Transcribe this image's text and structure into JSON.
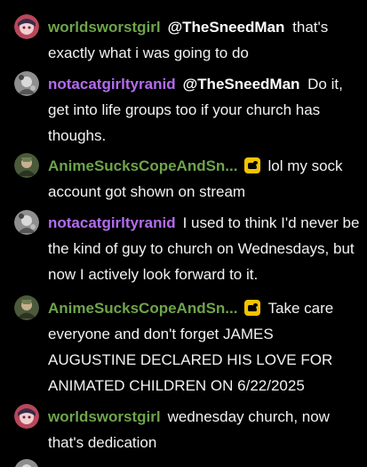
{
  "messages": [
    {
      "username": "worldsworstgirl",
      "user_color": "#6ea44b",
      "avatar": "anime-girl-avatar",
      "mention": "@TheSneedMan",
      "text": "that's exactly what i was going to do"
    },
    {
      "username": "notacatgirltyranid",
      "user_color": "#b36cf0",
      "avatar": "grey-avatar",
      "mention": "@TheSneedMan",
      "text": "Do it, get into life groups too if your church has thoughs."
    },
    {
      "username": "AnimeSucksCopeAndSn...",
      "user_color": "#6ea44b",
      "avatar": "green-avatar",
      "badge": "sub-badge-icon",
      "text": "lol my sock account got shown on stream"
    },
    {
      "username": "notacatgirltyranid",
      "user_color": "#b36cf0",
      "avatar": "grey-avatar",
      "text": "I used to think I'd never be the kind of guy to church on Wednesdays, but now I actively look forward to it."
    },
    {
      "username": "AnimeSucksCopeAndSn...",
      "user_color": "#6ea44b",
      "avatar": "green-avatar",
      "badge": "sub-badge-icon",
      "text": "Take care everyone and don't forget JAMES AUGUSTINE DECLARED HIS LOVE FOR ANIMATED CHILDREN ON 6/22/2025"
    },
    {
      "username": "worldsworstgirl",
      "user_color": "#6ea44b",
      "avatar": "anime-girl-avatar",
      "text": "wednesday church, now that's dedication"
    }
  ]
}
